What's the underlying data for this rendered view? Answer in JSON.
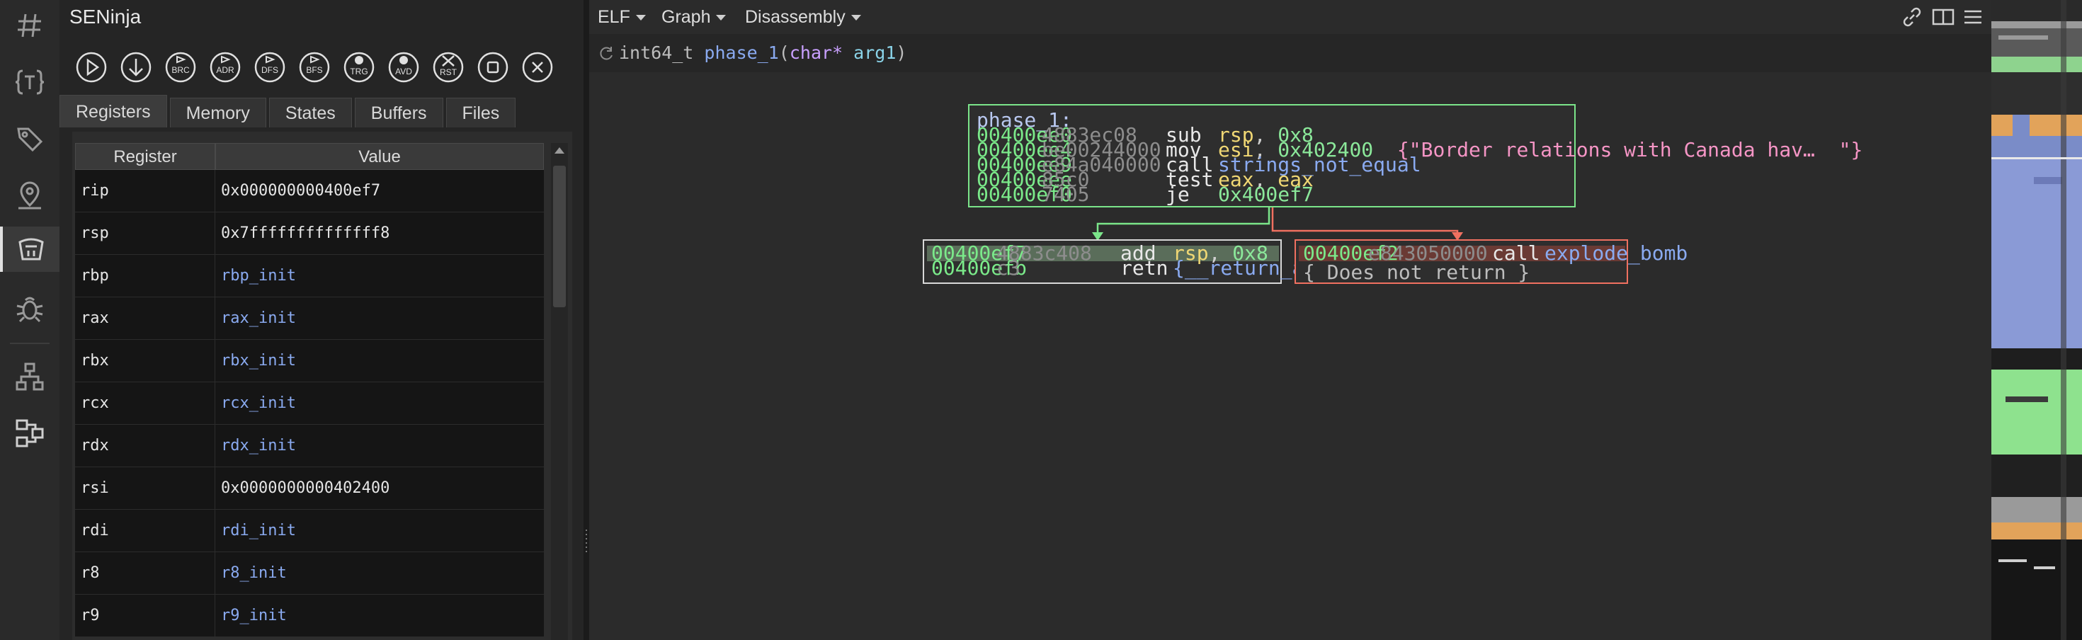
{
  "sidebar": {
    "title": "SENinja",
    "tabs": [
      "Registers",
      "Memory",
      "States",
      "Buffers",
      "Files"
    ],
    "active_tab": "Registers",
    "toolbar_labels": {
      "brc": "BRC",
      "adr": "ADR",
      "dfs": "DFS",
      "bfs": "BFS",
      "trg": "TRG",
      "avd": "AVD",
      "rst": "RST"
    },
    "table": {
      "headers": [
        "Register",
        "Value"
      ],
      "rows": [
        {
          "register": "rip",
          "value": "0x000000000400ef7",
          "symbolic": false
        },
        {
          "register": "rsp",
          "value": "0x7ffffffffffffff8",
          "symbolic": false
        },
        {
          "register": "rbp",
          "value": "rbp_init",
          "symbolic": true
        },
        {
          "register": "rax",
          "value": "rax_init",
          "symbolic": true
        },
        {
          "register": "rbx",
          "value": "rbx_init",
          "symbolic": true
        },
        {
          "register": "rcx",
          "value": "rcx_init",
          "symbolic": true
        },
        {
          "register": "rdx",
          "value": "rdx_init",
          "symbolic": true
        },
        {
          "register": "rsi",
          "value": "0x0000000000402400",
          "symbolic": false
        },
        {
          "register": "rdi",
          "value": "rdi_init",
          "symbolic": true
        },
        {
          "register": "r8",
          "value": "r8_init",
          "symbolic": true
        },
        {
          "register": "r9",
          "value": "r9_init",
          "symbolic": true
        }
      ]
    }
  },
  "header": {
    "menus": [
      "ELF",
      "Graph",
      "Disassembly"
    ]
  },
  "signature": {
    "return_type": "int64_t",
    "name": "phase_1",
    "open": "(",
    "param_type": "char*",
    "param_name": "arg1",
    "close": ")"
  },
  "graph": {
    "entry_block": {
      "label": "phase_1:",
      "lines": [
        {
          "addr": "00400ee0",
          "bytes": "4883ec08",
          "mnemonic": "sub",
          "op1": "rsp",
          "sep": ", ",
          "op2": "0x8",
          "comment": ""
        },
        {
          "addr": "00400ee4",
          "bytes": "be00244000",
          "mnemonic": "mov",
          "op1": "esi",
          "sep": ", ",
          "op2": "0x402400",
          "comment": "{\"Border relations with Canada hav…  \"}"
        },
        {
          "addr": "00400ee9",
          "bytes": "e84a040000",
          "mnemonic": "call",
          "op1": "",
          "sep": "",
          "op2": "strings_not_equal",
          "comment": ""
        },
        {
          "addr": "00400eee",
          "bytes": "85c0",
          "mnemonic": "test",
          "op1": "eax",
          "sep": ", ",
          "op2": "eax",
          "comment": ""
        },
        {
          "addr": "00400ef0",
          "bytes": "7405",
          "mnemonic": "je",
          "op1": "",
          "sep": "",
          "op2": "0x400ef7",
          "comment": ""
        }
      ]
    },
    "true_block": {
      "lines": [
        {
          "addr": "00400ef7",
          "bytes": "4883c408",
          "mnemonic": "add",
          "op1": "rsp",
          "sep": ", ",
          "op2": "0x8"
        },
        {
          "addr": "00400efb",
          "bytes": "c3",
          "mnemonic": "retn",
          "op1": "",
          "sep": "",
          "op2": "{__return_addr}"
        }
      ]
    },
    "false_block": {
      "lines": [
        {
          "addr": "00400ef2",
          "bytes": "e843050000",
          "mnemonic": "call",
          "op2": "explode_bomb"
        }
      ],
      "note": "{ Does not return }"
    }
  },
  "colors": {
    "true_edge": "#7be58a",
    "false_edge": "#f07060",
    "entry_border": "#7be58a",
    "true_border": "#d8d8d8",
    "false_border": "#f07060"
  }
}
